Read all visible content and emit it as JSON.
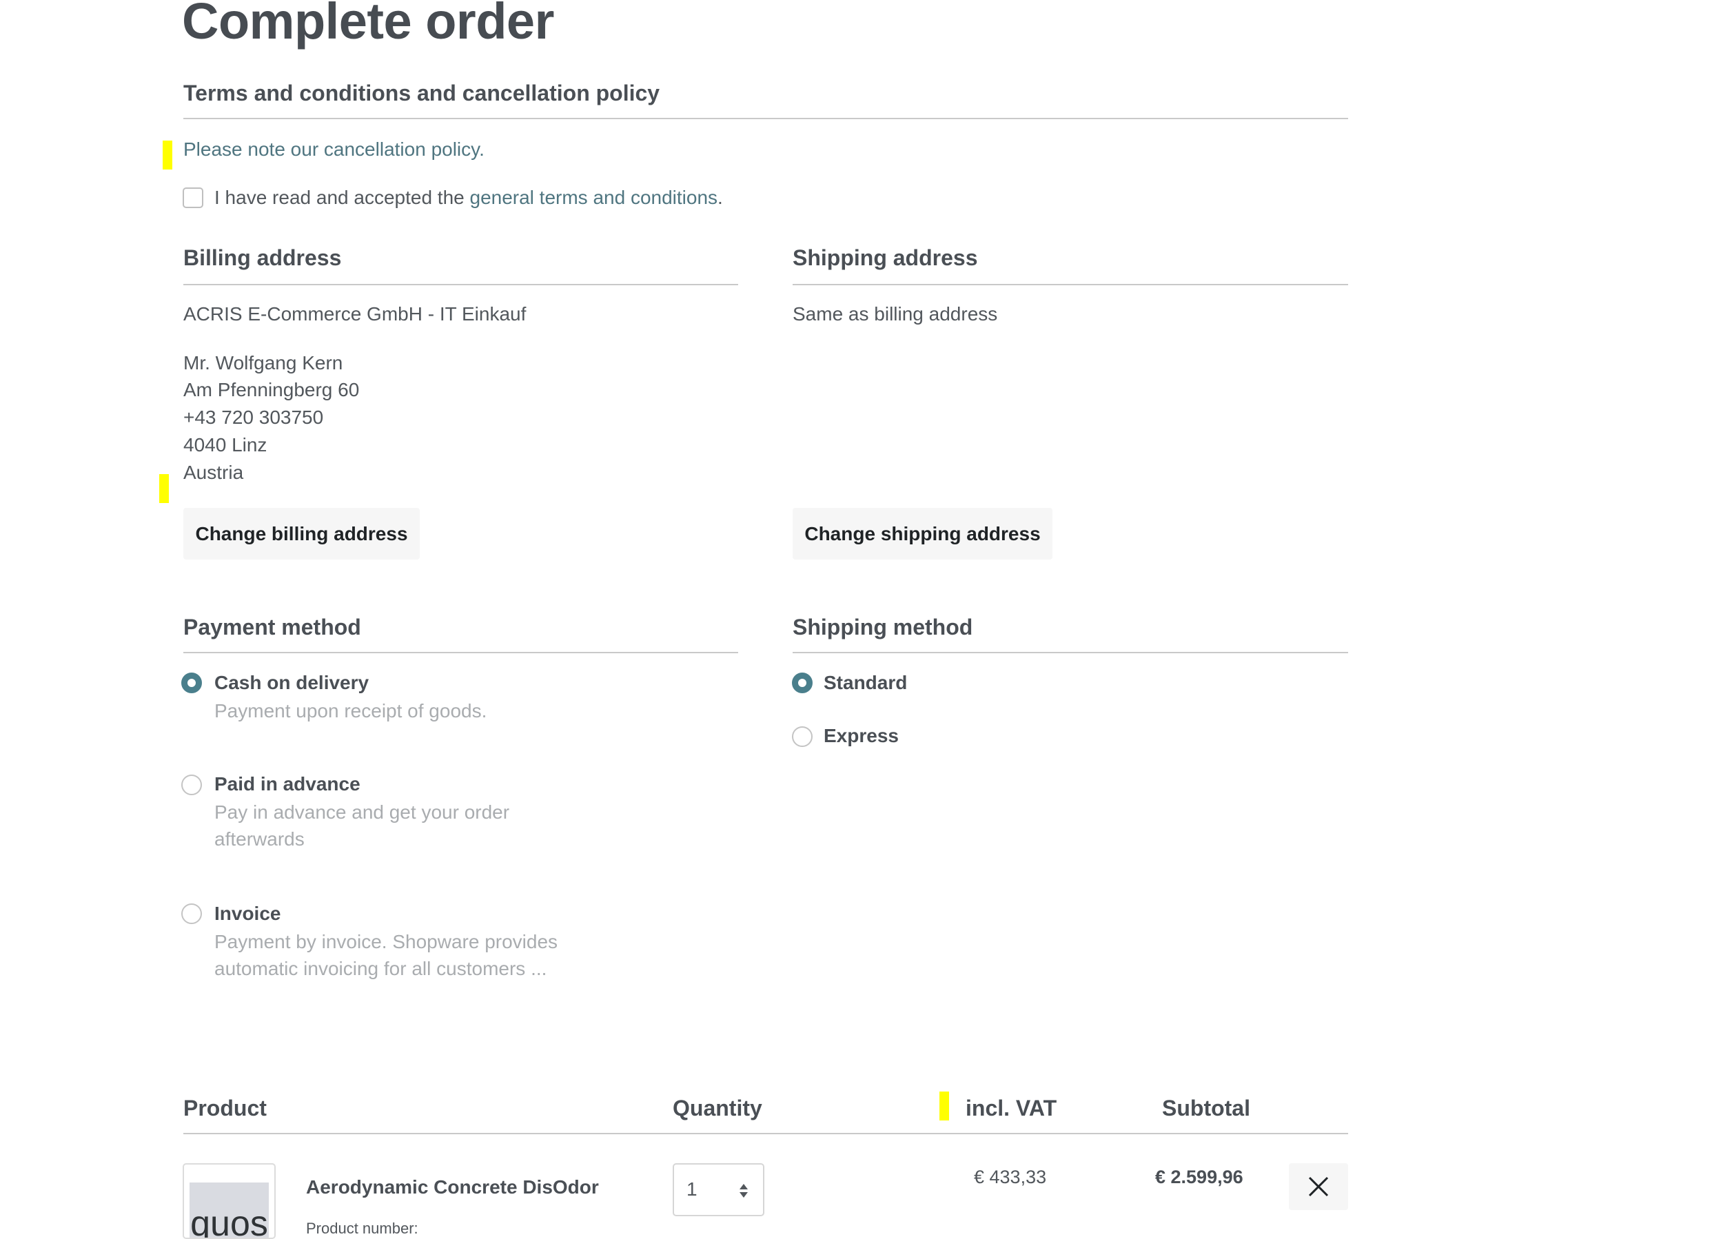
{
  "page": {
    "title": "Complete order"
  },
  "terms": {
    "heading": "Terms and conditions and cancellation policy",
    "cancellation_text": "Please note our cancellation policy.",
    "accept_prefix": "I have read and accepted the ",
    "accept_link": "general terms and conditions",
    "accept_suffix": ".",
    "accepted": false
  },
  "billing": {
    "heading": "Billing address",
    "company": "ACRIS E-Commerce GmbH - IT Einkauf",
    "lines": [
      "Mr. Wolfgang Kern",
      "Am Pfenningberg 60",
      "+43 720 303750",
      "4040 Linz",
      "Austria"
    ],
    "change_button": "Change billing address"
  },
  "shipping_address": {
    "heading": "Shipping address",
    "text": "Same as billing address",
    "change_button": "Change shipping address"
  },
  "payment": {
    "heading": "Payment method",
    "options": [
      {
        "label": "Cash on delivery",
        "description": "Payment upon receipt of goods.",
        "selected": true
      },
      {
        "label": "Paid in advance",
        "description": "Pay in advance and get your order afterwards",
        "selected": false
      },
      {
        "label": "Invoice",
        "description": "Payment by invoice. Shopware provides automatic invoicing for all customers ...",
        "selected": false
      }
    ]
  },
  "shipping_method": {
    "heading": "Shipping method",
    "options": [
      {
        "label": "Standard",
        "selected": true
      },
      {
        "label": "Express",
        "selected": false
      }
    ]
  },
  "cart": {
    "headers": {
      "product": "Product",
      "quantity": "Quantity",
      "vat": "incl. VAT",
      "subtotal": "Subtotal"
    },
    "items": [
      {
        "thumb_text": "quos",
        "name": "Aerodynamic Concrete DisOdor",
        "number_label": "Product number:",
        "quantity": "1",
        "vat": "€ 433,33",
        "subtotal": "€ 2.599,96"
      }
    ]
  },
  "colors": {
    "accent": "#4a7f8c",
    "link": "#4f7580",
    "highlight": "#ffff00"
  }
}
